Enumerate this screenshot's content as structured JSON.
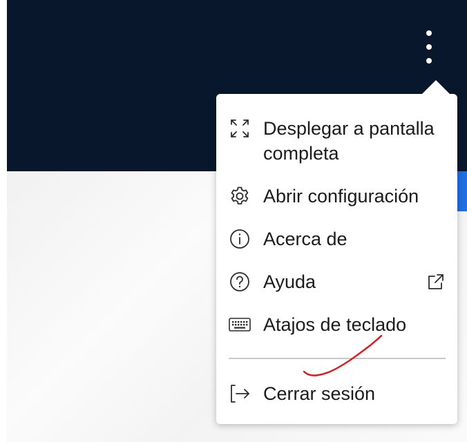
{
  "header": {
    "menu_button_icon": "kebab-vertical-icon"
  },
  "menu": {
    "items": [
      {
        "id": "fullscreen",
        "icon": "expand-icon",
        "label": "Desplegar a pantalla completa"
      },
      {
        "id": "settings",
        "icon": "gear-icon",
        "label": "Abrir configuración"
      },
      {
        "id": "about",
        "icon": "info-icon",
        "label": "Acerca de"
      },
      {
        "id": "help",
        "icon": "help-icon",
        "label": "Ayuda",
        "trailing_icon": "external-link-icon"
      },
      {
        "id": "shortcuts",
        "icon": "keyboard-icon",
        "label": "Atajos de teclado"
      },
      {
        "id": "logout",
        "icon": "logout-icon",
        "label": "Cerrar sesión"
      }
    ]
  },
  "colors": {
    "header_bg": "#08172b",
    "accent_blue": "#1f6fe0",
    "menu_text": "#1b1b1b",
    "icon_stroke": "#2b2b2b",
    "annotation_red": "#e0151b"
  }
}
